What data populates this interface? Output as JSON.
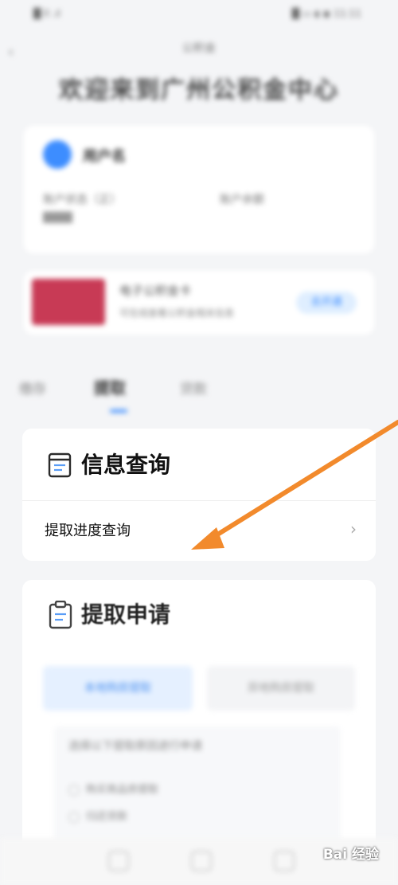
{
  "status": {
    "left": "█ ll .ıl",
    "right": "█ ▭ ◖ ◉ 11:11"
  },
  "nav": {
    "back": "‹",
    "subtitle": "公积金",
    "title": "欢迎来到广州公积金中心"
  },
  "account": {
    "name": "用户名",
    "label_1": "账户状态（正）",
    "value_1": "████",
    "label_2": "账户余额"
  },
  "bank": {
    "title": "电子公积金卡",
    "desc": "可在线查看公积金相关信息",
    "button": "去开通"
  },
  "tabs": [
    {
      "label": "缴存"
    },
    {
      "label": "提取"
    },
    {
      "label": "贷款"
    }
  ],
  "info": {
    "title": "信息查询",
    "row_label": "提取进度查询",
    "row_chevron": "›"
  },
  "apply": {
    "title": "提取申请",
    "tab_1": "本地购房提取",
    "tab_2": "异地购房提取",
    "note": "选择以下提取原因进行申请",
    "option_1": "购买商品房提取",
    "option_2": "归还贷款"
  },
  "watermark": "Bai 经验",
  "colors": {
    "accent": "#3d8dff",
    "arrow": "#f28a2c",
    "bank_card": "#c83a55"
  }
}
